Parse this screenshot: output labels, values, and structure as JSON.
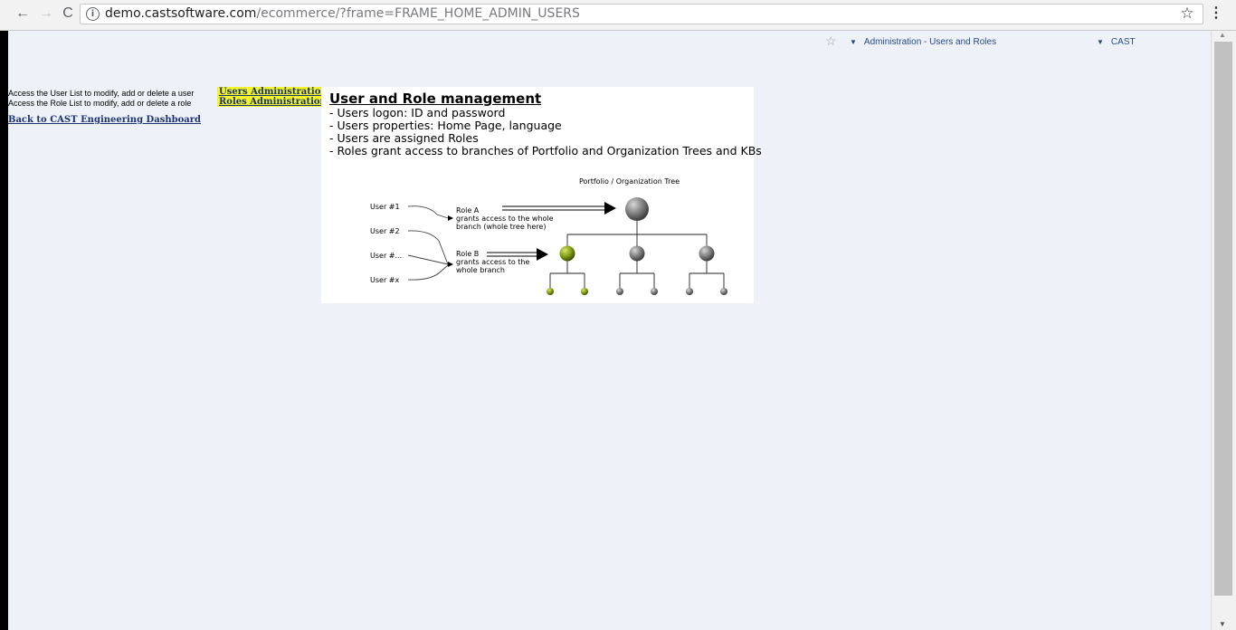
{
  "browser": {
    "url_host": "demo.castsoftware.com",
    "url_rest": "/ecommerce/?frame=FRAME_HOME_ADMIN_USERS"
  },
  "topbar": {
    "admin_menu": "Administration - Users and Roles",
    "cast_menu": "CAST"
  },
  "left": {
    "users_text": "Access the User List to modify, add or delete a user",
    "users_link": "Users Administration",
    "roles_text": "Access the Role List to modify, add or delete a role",
    "roles_link": "Roles Administration",
    "back_link": "Back to CAST Engineering Dashboard"
  },
  "panel": {
    "title": "User and Role management",
    "bullets": [
      "- Users logon: ID and password",
      "- Users properties: Home Page, language",
      "- Users are assigned Roles",
      "- Roles grant access to branches of Portfolio and Organization Trees and KBs"
    ],
    "diagram": {
      "tree_label": "Portfolio / Organization Tree",
      "users": [
        "User #1",
        "User #2",
        "User #...",
        "User #x"
      ],
      "role_a": [
        "Role A",
        "grants access to the whole",
        "branch (whole tree here)"
      ],
      "role_b": [
        "Role B",
        "grants access to the",
        "whole branch"
      ]
    }
  }
}
